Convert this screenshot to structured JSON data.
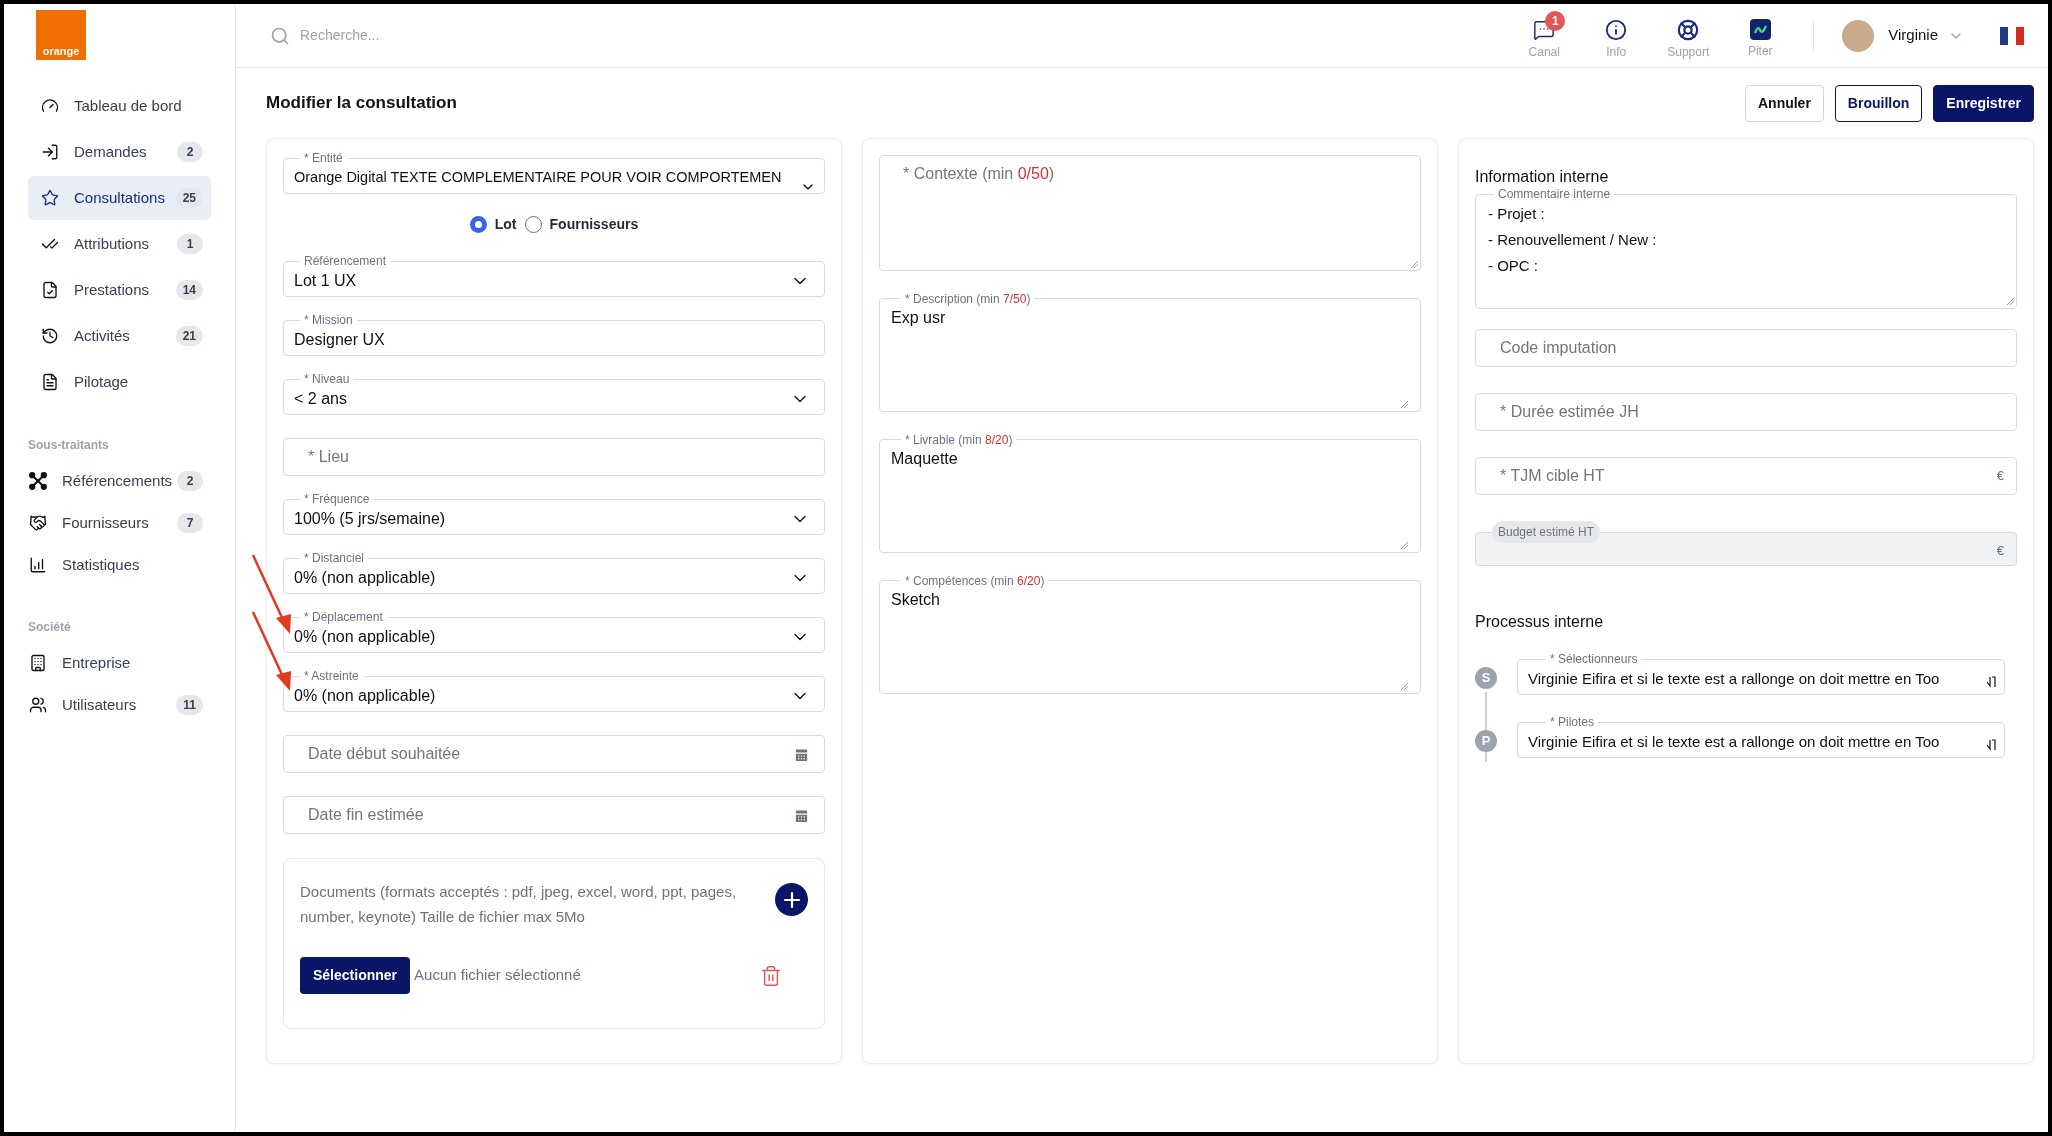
{
  "sidebar": {
    "logo_text": "orange",
    "groups": [
      {
        "items": [
          {
            "label": "Tableau de bord",
            "selected": false
          },
          {
            "label": "Demandes",
            "count": "2",
            "selected": false
          },
          {
            "label": "Consultations",
            "count": "25",
            "selected": true
          },
          {
            "label": "Attributions",
            "count": "1",
            "selected": false
          },
          {
            "label": "Prestations",
            "count": "14",
            "selected": false
          },
          {
            "label": "Activités",
            "count": "21",
            "selected": false
          },
          {
            "label": "Pilotage",
            "selected": false
          }
        ]
      },
      {
        "heading": "Sous-traitants",
        "items": [
          {
            "label": "Référencements",
            "count": "2",
            "selected": false
          },
          {
            "label": "Fournisseurs",
            "count": "7",
            "selected": false
          },
          {
            "label": "Statistiques",
            "selected": false
          }
        ]
      },
      {
        "heading": "Société",
        "items": [
          {
            "label": "Entreprise",
            "selected": false
          },
          {
            "label": "Utilisateurs",
            "count": "11",
            "selected": false
          }
        ]
      }
    ]
  },
  "topbar": {
    "search": {
      "placeholder": "Recherche..."
    },
    "nav": [
      {
        "label": "Canal",
        "badge": "1"
      },
      {
        "label": "Info"
      },
      {
        "label": "Support"
      },
      {
        "label": "Piter"
      }
    ],
    "user": {
      "name": "Virginie"
    }
  },
  "header": {
    "title": "Modifier la consultation",
    "buttons": [
      {
        "label": "Annuler",
        "kind": "outline"
      },
      {
        "label": "Brouillon",
        "kind": "secondary"
      },
      {
        "label": "Enregistrer",
        "kind": "primary"
      }
    ]
  },
  "left": {
    "entity": {
      "label": "* Entité",
      "value": "Orange Digital TEXTE COMPLEMENTAIRE POUR VOIR COMPORTEMEN"
    },
    "radios": [
      {
        "label": "Lot",
        "selected": true
      },
      {
        "label": "Fournisseurs",
        "selected": false
      }
    ],
    "fields": [
      {
        "kind": "select",
        "label": "Référencement",
        "value": "Lot 1 UX"
      },
      {
        "kind": "text",
        "label": "* Mission",
        "value": "Designer UX"
      },
      {
        "kind": "select",
        "label": "* Niveau",
        "value": "< 2 ans"
      },
      {
        "kind": "text",
        "placeholder": "* Lieu"
      },
      {
        "kind": "select",
        "label": "* Fréquence",
        "value": "100% (5 jrs/semaine)"
      },
      {
        "kind": "select",
        "label": "* Distanciel",
        "value": "0% (non applicable)"
      },
      {
        "kind": "select",
        "label": "* Déplacement",
        "value": "0% (non applicable)"
      },
      {
        "kind": "select",
        "label": "* Astreinte",
        "value": "0% (non applicable)"
      },
      {
        "kind": "date",
        "placeholder": "Date début souhaitée"
      },
      {
        "kind": "date",
        "placeholder": "Date fin estimée"
      }
    ],
    "documents": {
      "text": "Documents (formats acceptés : pdf, jpeg, excel, word, ppt, pages, number, keynote) Taille de fichier max 5Mo",
      "button": "Sélectionner",
      "status": "Aucun fichier sélectionné"
    }
  },
  "middle": {
    "textareas": [
      {
        "label": "* Contexte (min ",
        "count": "0/50",
        "after": ")"
      },
      {
        "label": "* Description (min ",
        "count": "7/50",
        "after": ")",
        "value": "Exp usr"
      },
      {
        "label": "* Livrable (min ",
        "count": "8/20",
        "after": ")",
        "value": "Maquette"
      },
      {
        "label": "* Compétences (min ",
        "count": "6/20",
        "after": ")",
        "value": "Sketch"
      }
    ]
  },
  "right": {
    "info_heading": "Information interne",
    "comment": {
      "label": "Commentaire interne",
      "lines": [
        "- Projet :",
        "- Renouvellement / New :",
        "- OPC :"
      ]
    },
    "fields": [
      {
        "placeholder": "Code imputation",
        "disabled": false
      },
      {
        "placeholder": "* Durée estimée JH",
        "disabled": false
      },
      {
        "placeholder": "* TJM cible HT",
        "suffix": "€",
        "disabled": false
      },
      {
        "label": "Budget estimé HT",
        "suffix": "€",
        "disabled": true
      }
    ],
    "process_heading": "Processus interne",
    "steps": [
      {
        "initial": "S",
        "label": "* Sélectionneurs",
        "value": "Virginie Eifira et si le texte est a rallonge on doit mettre en Too"
      },
      {
        "initial": "P",
        "label": "* Pilotes",
        "value": "Virginie Eifira et si le texte est a rallonge on doit mettre en Too"
      }
    ]
  }
}
